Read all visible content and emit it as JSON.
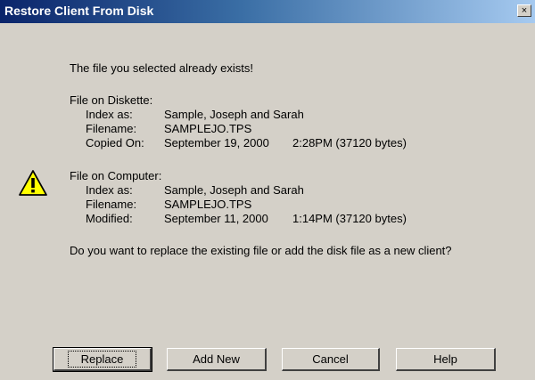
{
  "dialog": {
    "title": "Restore Client From Disk",
    "close_glyph": "×",
    "message": "The file you selected already exists!",
    "diskette": {
      "heading": "File on Diskette:",
      "index_label": "Index as:",
      "index_value": "Sample, Joseph and Sarah",
      "filename_label": "Filename:",
      "filename_value": "SAMPLEJO.TPS",
      "date_label": "Copied On:",
      "date_value": "September 19, 2000",
      "time_value": "2:28PM (37120 bytes)"
    },
    "computer": {
      "heading": "File on Computer:",
      "index_label": "Index as:",
      "index_value": "Sample, Joseph and Sarah",
      "filename_label": "Filename:",
      "filename_value": "SAMPLEJO.TPS",
      "date_label": "Modified:",
      "date_value": "September 11, 2000",
      "time_value": "1:14PM (37120 bytes)"
    },
    "question": "Do you want to replace the existing file or add the disk file as a new client?",
    "icon": "warning-icon",
    "buttons": {
      "replace": "Replace",
      "add_new": "Add New",
      "cancel": "Cancel",
      "help": "Help"
    }
  }
}
